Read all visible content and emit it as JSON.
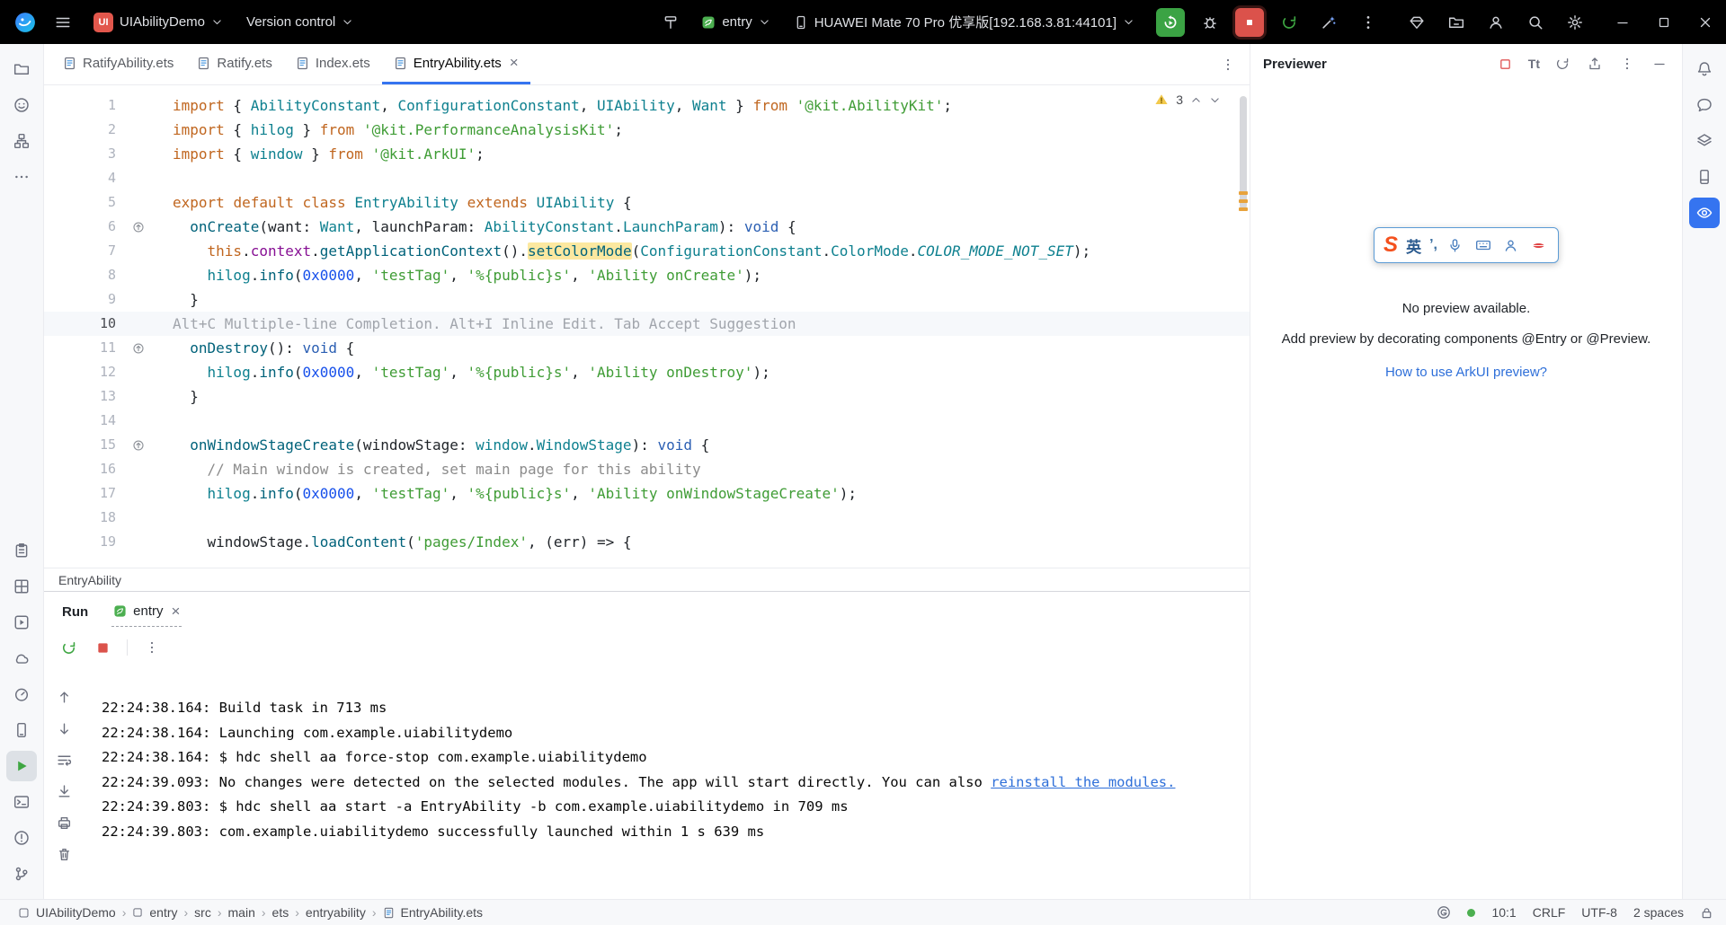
{
  "colors": {
    "accent": "#3574F0",
    "run_green": "#3BA344",
    "stop_red": "#DB524B",
    "warning_yellow": "#F2C94C",
    "link_blue": "#2E6FD9"
  },
  "title_bar": {
    "project_badge": "UI",
    "project_name": "UIAbilityDemo",
    "version_control_label": "Version control",
    "run_config_label": "entry",
    "device_label": "HUAWEI Mate 70 Pro 优享版[192.168.3.81:44101]"
  },
  "editor": {
    "tabs": [
      {
        "label": "RatifyAbility.ets"
      },
      {
        "label": "Ratify.ets"
      },
      {
        "label": "Index.ets"
      },
      {
        "label": "EntryAbility.ets"
      }
    ],
    "active_tab_index": 3,
    "inspection_warnings": "3",
    "breadcrumb": "EntryAbility",
    "code_lines": [
      {
        "n": 1,
        "t": [
          [
            "import",
            "kw"
          ],
          [
            " { ",
            ""
          ],
          [
            "AbilityConstant",
            "ty"
          ],
          [
            ", ",
            ""
          ],
          [
            "ConfigurationConstant",
            "ty"
          ],
          [
            ", ",
            ""
          ],
          [
            "UIAbility",
            "ty"
          ],
          [
            ", ",
            ""
          ],
          [
            "Want",
            "ty"
          ],
          [
            " } ",
            ""
          ],
          [
            "from",
            "kw"
          ],
          [
            " ",
            ""
          ],
          [
            "'@kit.AbilityKit'",
            "str"
          ],
          [
            ";",
            ""
          ]
        ]
      },
      {
        "n": 2,
        "t": [
          [
            "import",
            "kw"
          ],
          [
            " { ",
            ""
          ],
          [
            "hilog",
            "ty"
          ],
          [
            " } ",
            ""
          ],
          [
            "from",
            "kw"
          ],
          [
            " ",
            ""
          ],
          [
            "'@kit.PerformanceAnalysisKit'",
            "str"
          ],
          [
            ";",
            ""
          ]
        ]
      },
      {
        "n": 3,
        "t": [
          [
            "import",
            "kw"
          ],
          [
            " { ",
            ""
          ],
          [
            "window",
            "ty"
          ],
          [
            " } ",
            ""
          ],
          [
            "from",
            "kw"
          ],
          [
            " ",
            ""
          ],
          [
            "'@kit.ArkUI'",
            "str"
          ],
          [
            ";",
            ""
          ]
        ]
      },
      {
        "n": 4,
        "t": []
      },
      {
        "n": 5,
        "t": [
          [
            "export",
            "kw"
          ],
          [
            " ",
            ""
          ],
          [
            "default",
            "kw"
          ],
          [
            " ",
            ""
          ],
          [
            "class",
            "kw"
          ],
          [
            " ",
            ""
          ],
          [
            "EntryAbility",
            "ty"
          ],
          [
            " ",
            ""
          ],
          [
            "extends",
            "kw"
          ],
          [
            " ",
            ""
          ],
          [
            "UIAbility",
            "ty"
          ],
          [
            " {",
            ""
          ]
        ]
      },
      {
        "n": 6,
        "g": "override",
        "t": [
          [
            "  ",
            ""
          ],
          [
            "onCreate",
            "fn"
          ],
          [
            "(want: ",
            ""
          ],
          [
            "Want",
            "ty"
          ],
          [
            ", launchParam: ",
            ""
          ],
          [
            "AbilityConstant",
            "ty"
          ],
          [
            ".",
            ""
          ],
          [
            "LaunchParam",
            "ty"
          ],
          [
            "): ",
            ""
          ],
          [
            "void",
            "prim"
          ],
          [
            " {",
            ""
          ]
        ]
      },
      {
        "n": 7,
        "t": [
          [
            "    ",
            ""
          ],
          [
            "this",
            "kw"
          ],
          [
            ".",
            ""
          ],
          [
            "context",
            "field"
          ],
          [
            ".",
            ""
          ],
          [
            "getApplicationContext",
            "fn"
          ],
          [
            "().",
            ""
          ],
          [
            "setColorMode",
            "hl"
          ],
          [
            "(",
            ""
          ],
          [
            "ConfigurationConstant",
            "ty"
          ],
          [
            ".",
            ""
          ],
          [
            "ColorMode",
            "ty"
          ],
          [
            ".",
            ""
          ],
          [
            "COLOR_MODE_NOT_SET",
            "const"
          ],
          [
            ");",
            ""
          ]
        ]
      },
      {
        "n": 8,
        "t": [
          [
            "    ",
            ""
          ],
          [
            "hilog",
            "ty"
          ],
          [
            ".",
            ""
          ],
          [
            "info",
            "fn"
          ],
          [
            "(",
            ""
          ],
          [
            "0x0000",
            "num"
          ],
          [
            ", ",
            ""
          ],
          [
            "'testTag'",
            "str"
          ],
          [
            ", ",
            ""
          ],
          [
            "'%{public}s'",
            "str"
          ],
          [
            ", ",
            ""
          ],
          [
            "'Ability onCreate'",
            "str"
          ],
          [
            ");",
            ""
          ]
        ]
      },
      {
        "n": 9,
        "t": [
          [
            "  }",
            ""
          ]
        ]
      },
      {
        "n": 10,
        "a": true,
        "t": [
          [
            "Alt+C Multiple-line Completion. Alt+I Inline Edit. Tab Accept Suggestion",
            "ghost"
          ]
        ]
      },
      {
        "n": 11,
        "g": "override",
        "t": [
          [
            "  ",
            ""
          ],
          [
            "onDestroy",
            "fn"
          ],
          [
            "(): ",
            ""
          ],
          [
            "void",
            "prim"
          ],
          [
            " {",
            ""
          ]
        ]
      },
      {
        "n": 12,
        "t": [
          [
            "    ",
            ""
          ],
          [
            "hilog",
            "ty"
          ],
          [
            ".",
            ""
          ],
          [
            "info",
            "fn"
          ],
          [
            "(",
            ""
          ],
          [
            "0x0000",
            "num"
          ],
          [
            ", ",
            ""
          ],
          [
            "'testTag'",
            "str"
          ],
          [
            ", ",
            ""
          ],
          [
            "'%{public}s'",
            "str"
          ],
          [
            ", ",
            ""
          ],
          [
            "'Ability onDestroy'",
            "str"
          ],
          [
            ");",
            ""
          ]
        ]
      },
      {
        "n": 13,
        "t": [
          [
            "  }",
            ""
          ]
        ]
      },
      {
        "n": 14,
        "t": []
      },
      {
        "n": 15,
        "g": "override",
        "t": [
          [
            "  ",
            ""
          ],
          [
            "onWindowStageCreate",
            "fn"
          ],
          [
            "(windowStage: ",
            ""
          ],
          [
            "window",
            "ty"
          ],
          [
            ".",
            ""
          ],
          [
            "WindowStage",
            "ty"
          ],
          [
            "): ",
            ""
          ],
          [
            "void",
            "prim"
          ],
          [
            " {",
            ""
          ]
        ]
      },
      {
        "n": 16,
        "t": [
          [
            "    ",
            ""
          ],
          [
            "// Main window is created, set main page for this ability",
            "cm"
          ]
        ]
      },
      {
        "n": 17,
        "t": [
          [
            "    ",
            ""
          ],
          [
            "hilog",
            "ty"
          ],
          [
            ".",
            ""
          ],
          [
            "info",
            "fn"
          ],
          [
            "(",
            ""
          ],
          [
            "0x0000",
            "num"
          ],
          [
            ", ",
            ""
          ],
          [
            "'testTag'",
            "str"
          ],
          [
            ", ",
            ""
          ],
          [
            "'%{public}s'",
            "str"
          ],
          [
            ", ",
            ""
          ],
          [
            "'Ability onWindowStageCreate'",
            "str"
          ],
          [
            ");",
            ""
          ]
        ]
      },
      {
        "n": 18,
        "t": []
      },
      {
        "n": 19,
        "t": [
          [
            "    windowStage.",
            ""
          ],
          [
            "loadContent",
            "fn"
          ],
          [
            "(",
            ""
          ],
          [
            "'pages/Index'",
            "str"
          ],
          [
            ", (err) => {",
            ""
          ]
        ]
      }
    ]
  },
  "previewer": {
    "title": "Previewer",
    "text_tool_label": "Tt",
    "empty_title": "No preview available.",
    "empty_hint": "Add preview by decorating components @Entry or @Preview.",
    "help_link": "How to use ArkUI preview?",
    "ime_bar": {
      "logo": "S",
      "lang": "英",
      "punct": "’,"
    }
  },
  "run_panel": {
    "title": "Run",
    "tab_label": "entry",
    "console_lines": [
      {
        "text": "22:24:38.164: Build task in 713 ms"
      },
      {
        "text": "22:24:38.164: Launching com.example.uiabilitydemo"
      },
      {
        "text": "22:24:38.164: $ hdc shell aa force-stop com.example.uiabilitydemo"
      },
      {
        "text": "22:24:39.093: No changes were detected on the selected modules. The app will start directly. You can also ",
        "link": "reinstall the modules."
      },
      {
        "text": "22:24:39.803: $ hdc shell aa start -a EntryAbility -b com.example.uiabilitydemo in 709 ms"
      },
      {
        "text": "22:24:39.803: com.example.uiabilitydemo successfully launched within 1 s 639 ms"
      }
    ]
  },
  "status_bar": {
    "breadcrumbs": [
      "UIAbilityDemo",
      "entry",
      "src",
      "main",
      "ets",
      "entryability",
      "EntryAbility.ets"
    ],
    "caret_position": "10:1",
    "line_separator": "CRLF",
    "encoding": "UTF-8",
    "indent": "2 spaces"
  },
  "stripes": {
    "left_top": [
      {
        "name": "project-icon"
      },
      {
        "name": "ai-assistant-icon"
      },
      {
        "name": "structure-icon"
      },
      {
        "name": "more-tools-icon"
      }
    ],
    "left_bottom": [
      {
        "name": "todo-icon"
      },
      {
        "name": "build-variants-icon"
      },
      {
        "name": "services-icon"
      },
      {
        "name": "cloud-icon"
      },
      {
        "name": "profiler-icon"
      },
      {
        "name": "device-file-browser-icon"
      },
      {
        "name": "run-icon",
        "active": true
      },
      {
        "name": "terminal-icon"
      },
      {
        "name": "problems-icon"
      },
      {
        "name": "version-control-icon"
      }
    ],
    "right": [
      {
        "name": "notifications-icon"
      },
      {
        "name": "ai-chat-icon"
      },
      {
        "name": "layers-icon"
      },
      {
        "name": "device-manager-icon"
      },
      {
        "name": "previewer-icon",
        "active": true,
        "accent": true
      }
    ]
  }
}
